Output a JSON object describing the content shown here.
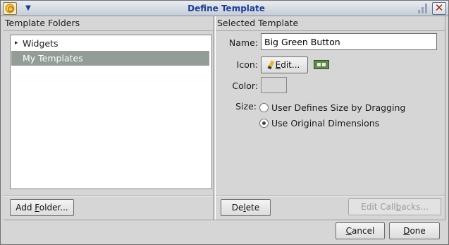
{
  "window": {
    "title": "Define Template",
    "icons": {
      "app": "app-emblem-icon",
      "menu": "window-menu-icon",
      "close": "close-icon"
    }
  },
  "left_panel": {
    "header": "Template Folders",
    "folders": [
      {
        "label": "Widgets",
        "expandable": true,
        "expander": "▸"
      },
      {
        "label": "My Templates",
        "selected": true
      }
    ],
    "add_folder_button": {
      "pre": "Add ",
      "accel": "F",
      "post": "older..."
    }
  },
  "right_panel": {
    "header": "Selected Template",
    "name_label": "Name:",
    "name_value": "Big Green Button",
    "icon_label": "Icon:",
    "icon_edit_button": {
      "accel": "E",
      "post": "dit..."
    },
    "color_label": "Color:",
    "size_label": "Size:",
    "size_options": [
      {
        "label": "User Defines Size by Dragging",
        "checked": false
      },
      {
        "label": "Use Original Dimensions",
        "checked": true
      }
    ],
    "delete_button": {
      "pre": "De",
      "accel": "l",
      "post": "ete"
    },
    "edit_callbacks_button": {
      "pre": "Edit Call",
      "accel": "b",
      "post": "acks...",
      "enabled": false
    }
  },
  "footer": {
    "cancel_button": {
      "accel": "C",
      "post": "ancel"
    },
    "done_button": {
      "accel": "D",
      "post": "one"
    }
  },
  "colors": {
    "title_text": "#1c3f93",
    "selection": "#939d95",
    "icon_green": "#5f8a50",
    "close_x": "#9b1d1d"
  }
}
